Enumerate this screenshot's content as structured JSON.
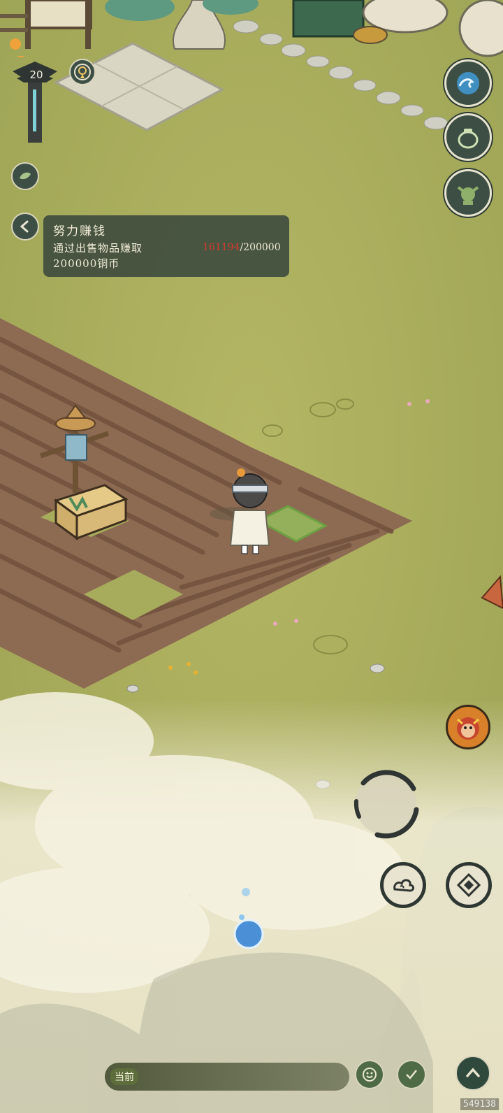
{
  "player": {
    "level": "20"
  },
  "quest": {
    "title": "努力赚钱",
    "description_line1": "通过出售物品赚取",
    "description_line2": "200000铜币",
    "progress_current": "161194",
    "progress_total": "/200000"
  },
  "chat": {
    "channel_label": "当前"
  },
  "footer": {
    "uid": "549138"
  },
  "colors": {
    "panel": "#3a483c",
    "progress_current": "#d63a2e",
    "button_bg": "#3d4f45",
    "grass": "#a9ad5a",
    "soil": "#8d6a52"
  },
  "icons": {
    "top_right": [
      "wave-icon",
      "pot-icon",
      "goblin-icon"
    ],
    "left": [
      "leaf-icon",
      "chevron-left-icon"
    ],
    "controls": [
      "joystick",
      "cloud-swirl-icon",
      "diamond-action-icon",
      "monkey-portrait-icon"
    ],
    "bottom": [
      "emoji-icon",
      "brush-check-icon",
      "chevron-up-icon"
    ]
  }
}
